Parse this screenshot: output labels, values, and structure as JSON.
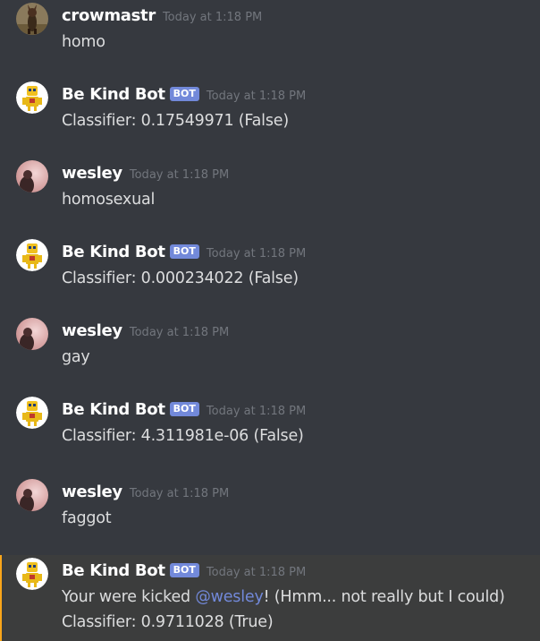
{
  "messages": [
    {
      "author": "crowmastr",
      "bot": false,
      "avatar_icon": "dog-avatar-icon",
      "timestamp": "Today at 1:18 PM",
      "lines": [
        "homo"
      ]
    },
    {
      "author": "Be Kind Bot",
      "bot": true,
      "bot_tag": "BOT",
      "avatar_icon": "robot-avatar-icon",
      "timestamp": "Today at 1:18 PM",
      "lines": [
        "Classifier: 0.17549971 (False)"
      ]
    },
    {
      "author": "wesley",
      "bot": false,
      "avatar_icon": "user-photo-avatar-icon",
      "timestamp": "Today at 1:18 PM",
      "lines": [
        "homosexual"
      ]
    },
    {
      "author": "Be Kind Bot",
      "bot": true,
      "bot_tag": "BOT",
      "avatar_icon": "robot-avatar-icon",
      "timestamp": "Today at 1:18 PM",
      "lines": [
        "Classifier: 0.000234022 (False)"
      ]
    },
    {
      "author": "wesley",
      "bot": false,
      "avatar_icon": "user-photo-avatar-icon",
      "timestamp": "Today at 1:18 PM",
      "lines": [
        "gay"
      ]
    },
    {
      "author": "Be Kind Bot",
      "bot": true,
      "bot_tag": "BOT",
      "avatar_icon": "robot-avatar-icon",
      "timestamp": "Today at 1:18 PM",
      "lines": [
        "Classifier: 4.311981e-06 (False)"
      ]
    },
    {
      "author": "wesley",
      "bot": false,
      "avatar_icon": "user-photo-avatar-icon",
      "timestamp": "Today at 1:18 PM",
      "lines": [
        "faggot"
      ]
    },
    {
      "author": "Be Kind Bot",
      "bot": true,
      "bot_tag": "BOT",
      "avatar_icon": "robot-avatar-icon",
      "timestamp": "Today at 1:18 PM",
      "kick_line": {
        "before": "Your were kicked ",
        "mention": "@wesley",
        "after": "! (Hmm... not really but I could)"
      },
      "lines": [
        "Classifier: 0.9711028 (True)"
      ]
    }
  ],
  "colors": {
    "background": "#36393f",
    "highlight_background": "#3c3d3d",
    "highlight_border": "#faa61a",
    "username": "#ffffff",
    "text": "#dcddde",
    "timestamp": "#72767d",
    "bot_tag": "#7289da",
    "mention": "#7289da"
  }
}
